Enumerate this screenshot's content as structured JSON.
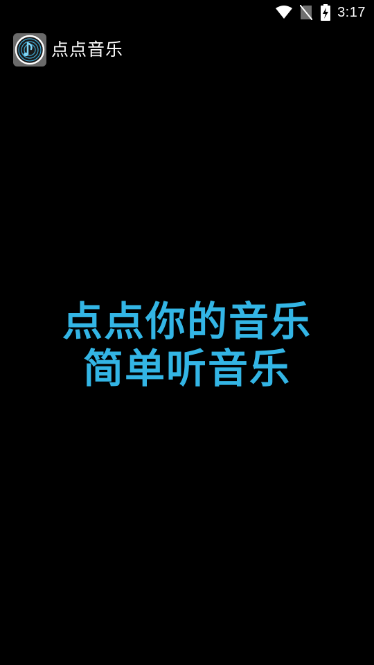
{
  "status_bar": {
    "time": "3:17",
    "icons": [
      "wifi-icon",
      "no-sim-icon",
      "battery-charging-icon"
    ]
  },
  "app_bar": {
    "title": "点点音乐",
    "icon": "music-note-disc-icon"
  },
  "main": {
    "line1": "点点你的音乐",
    "line2": "简单听音乐",
    "accent_color": "#33b5e5"
  }
}
